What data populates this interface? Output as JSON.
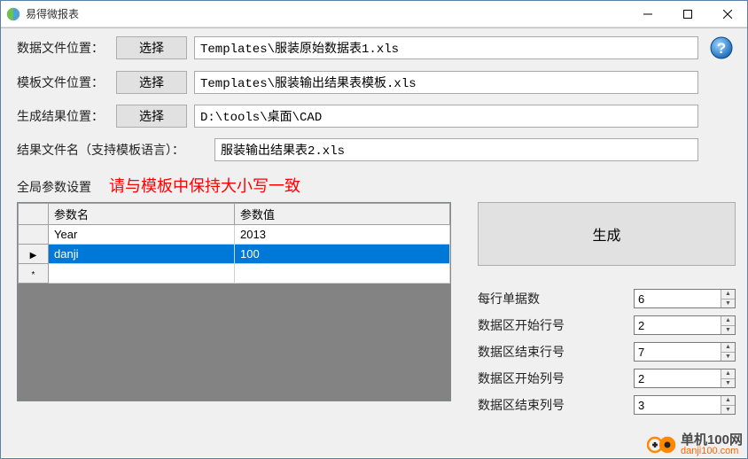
{
  "titlebar": {
    "title": "易得微报表"
  },
  "form": {
    "data_file_label": "数据文件位置：",
    "data_file_choose": "选择",
    "data_file_value": "Templates\\服装原始数据表1.xls",
    "template_file_label": "模板文件位置：",
    "template_file_choose": "选择",
    "template_file_value": "Templates\\服装输出结果表模板.xls",
    "result_location_label": "生成结果位置：",
    "result_location_choose": "选择",
    "result_location_value": "D:\\tools\\桌面\\CAD",
    "result_filename_label": "结果文件名（支持模板语言）：",
    "result_filename_value": "服装输出结果表2.xls"
  },
  "section": {
    "global_params_label": "全局参数设置",
    "red_hint": "请与模板中保持大小写一致"
  },
  "table": {
    "col_name": "参数名",
    "col_value": "参数值",
    "rows": [
      {
        "name": "Year",
        "value": "2013",
        "selected": false,
        "marker": ""
      },
      {
        "name": "danji",
        "value": "100",
        "selected": true,
        "marker": "▶"
      },
      {
        "name": "",
        "value": "",
        "selected": false,
        "marker": "*"
      }
    ]
  },
  "right": {
    "generate_label": "生成",
    "spinners": [
      {
        "label": "每行单据数",
        "value": "6"
      },
      {
        "label": "数据区开始行号",
        "value": "2"
      },
      {
        "label": "数据区结束行号",
        "value": "7"
      },
      {
        "label": "数据区开始列号",
        "value": "2"
      },
      {
        "label": "数据区结束列号",
        "value": "3"
      }
    ]
  },
  "watermark": {
    "text1": "单机100网",
    "text2": "danji100.com"
  }
}
